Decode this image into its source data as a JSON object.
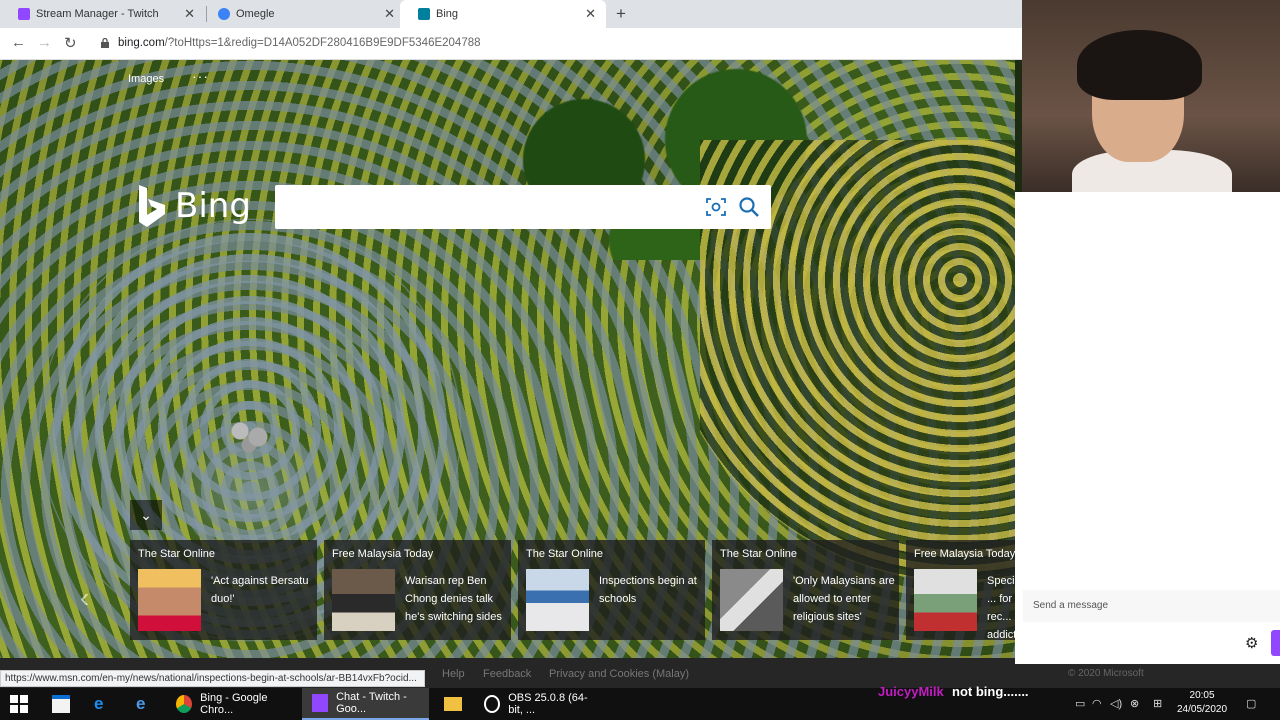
{
  "browser": {
    "tabs": [
      {
        "title": "Stream Manager - Twitch",
        "favicon": "twitch-icon",
        "color": "#9147ff"
      },
      {
        "title": "Omegle",
        "favicon": "omegle-icon",
        "color": "#3b82f6"
      },
      {
        "title": "Bing",
        "favicon": "bing-icon",
        "color": "#00809d"
      }
    ],
    "url_domain": "bing.com",
    "url_path": "/?toHttps=1&redig=D14A052DF280416B9E9DF5346E204788"
  },
  "bing": {
    "nav_images": "Images",
    "nav_more": "···",
    "logo_text": "Bing",
    "search_value": "",
    "news": [
      {
        "source": "The Star Online",
        "headline": "'Act against Bersatu duo!'"
      },
      {
        "source": "Free Malaysia Today",
        "headline": "Warisan rep Ben Chong denies talk he's switching sides"
      },
      {
        "source": "The Star Online",
        "headline": "Inspections begin at schools"
      },
      {
        "source": "The Star Online",
        "headline": "'Only Malaysians are allowed to enter religious sites'"
      },
      {
        "source": "Free Malaysia Today",
        "headline": "Special ... for rec... addict..."
      }
    ],
    "footer_links": [
      "Help",
      "Feedback",
      "Privacy and Cookies (Malay)"
    ],
    "copyright": "© 2020 Microsoft"
  },
  "status_bar": "https://www.msn.com/en-my/news/national/inspections-begin-at-schools/ar-BB14vxFb?ocid...",
  "chat": {
    "placeholder": "Send a message",
    "overlay_user": "JuicyyMilk",
    "overlay_message": "not bing......."
  },
  "taskbar": {
    "apps": [
      {
        "label": "Bing - Google Chro...",
        "icon": "chrome-icon"
      },
      {
        "label": "Chat - Twitch - Goo...",
        "icon": "twitch-icon"
      },
      {
        "label": "OBS 25.0.8 (64-bit, ...",
        "icon": "obs-icon"
      }
    ],
    "time": "20:05",
    "date": "24/05/2020"
  },
  "colors": {
    "twitch": "#9147ff",
    "bing": "#00809d",
    "overlay_user": "#c21cc2"
  }
}
